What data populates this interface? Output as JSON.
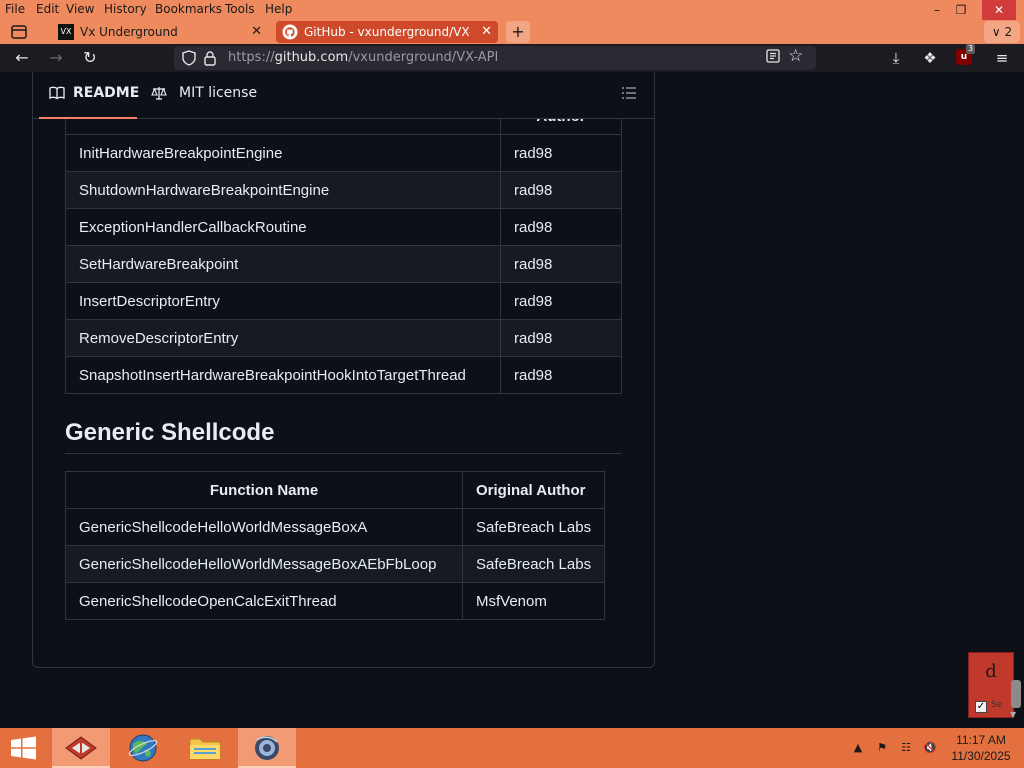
{
  "browser": {
    "menu": [
      "File",
      "Edit",
      "View",
      "History",
      "Bookmarks",
      "Tools",
      "Help"
    ],
    "tabs": [
      {
        "favicon": "VX",
        "title": "Vx Underground",
        "active": false
      },
      {
        "favicon": "github-icon",
        "title": "GitHub - vxunderground/VX-API",
        "active": true
      }
    ],
    "tab_count": "2",
    "url_prefix": "https://",
    "url_domain": "github.com",
    "url_path": "/vxunderground/VX-API",
    "ublock_count": "3"
  },
  "readme": {
    "tabs": {
      "readme": "README",
      "license": "MIT license"
    },
    "hidden_header": "Author"
  },
  "table1": {
    "rows": [
      {
        "name": "InitHardwareBreakpointEngine",
        "author": "rad98"
      },
      {
        "name": "ShutdownHardwareBreakpointEngine",
        "author": "rad98"
      },
      {
        "name": "ExceptionHandlerCallbackRoutine",
        "author": "rad98"
      },
      {
        "name": "SetHardwareBreakpoint",
        "author": "rad98"
      },
      {
        "name": "InsertDescriptorEntry",
        "author": "rad98"
      },
      {
        "name": "RemoveDescriptorEntry",
        "author": "rad98"
      },
      {
        "name": "SnapshotInsertHardwareBreakpointHookIntoTargetThread",
        "author": "rad98"
      }
    ]
  },
  "section": {
    "title": "Generic Shellcode"
  },
  "table2": {
    "headers": {
      "name": "Function Name",
      "author": "Original Author"
    },
    "rows": [
      {
        "name": "GenericShellcodeHelloWorldMessageBoxA",
        "author": "SafeBreach Labs"
      },
      {
        "name": "GenericShellcodeHelloWorldMessageBoxAEbFbLoop",
        "author": "SafeBreach Labs"
      },
      {
        "name": "GenericShellcodeOpenCalcExitThread",
        "author": "MsfVenom"
      }
    ]
  },
  "widget": {
    "letter": "d",
    "label": "Se"
  },
  "taskbar": {
    "time": "11:17 AM",
    "date": "11/30/2025"
  },
  "colors": {
    "theme_orange": "#ef8a5e",
    "active_tab": "#cf4a2b",
    "page_bg": "#0d1117",
    "border": "#30363d",
    "accent": "#f78166",
    "taskbar": "#e4703f"
  }
}
